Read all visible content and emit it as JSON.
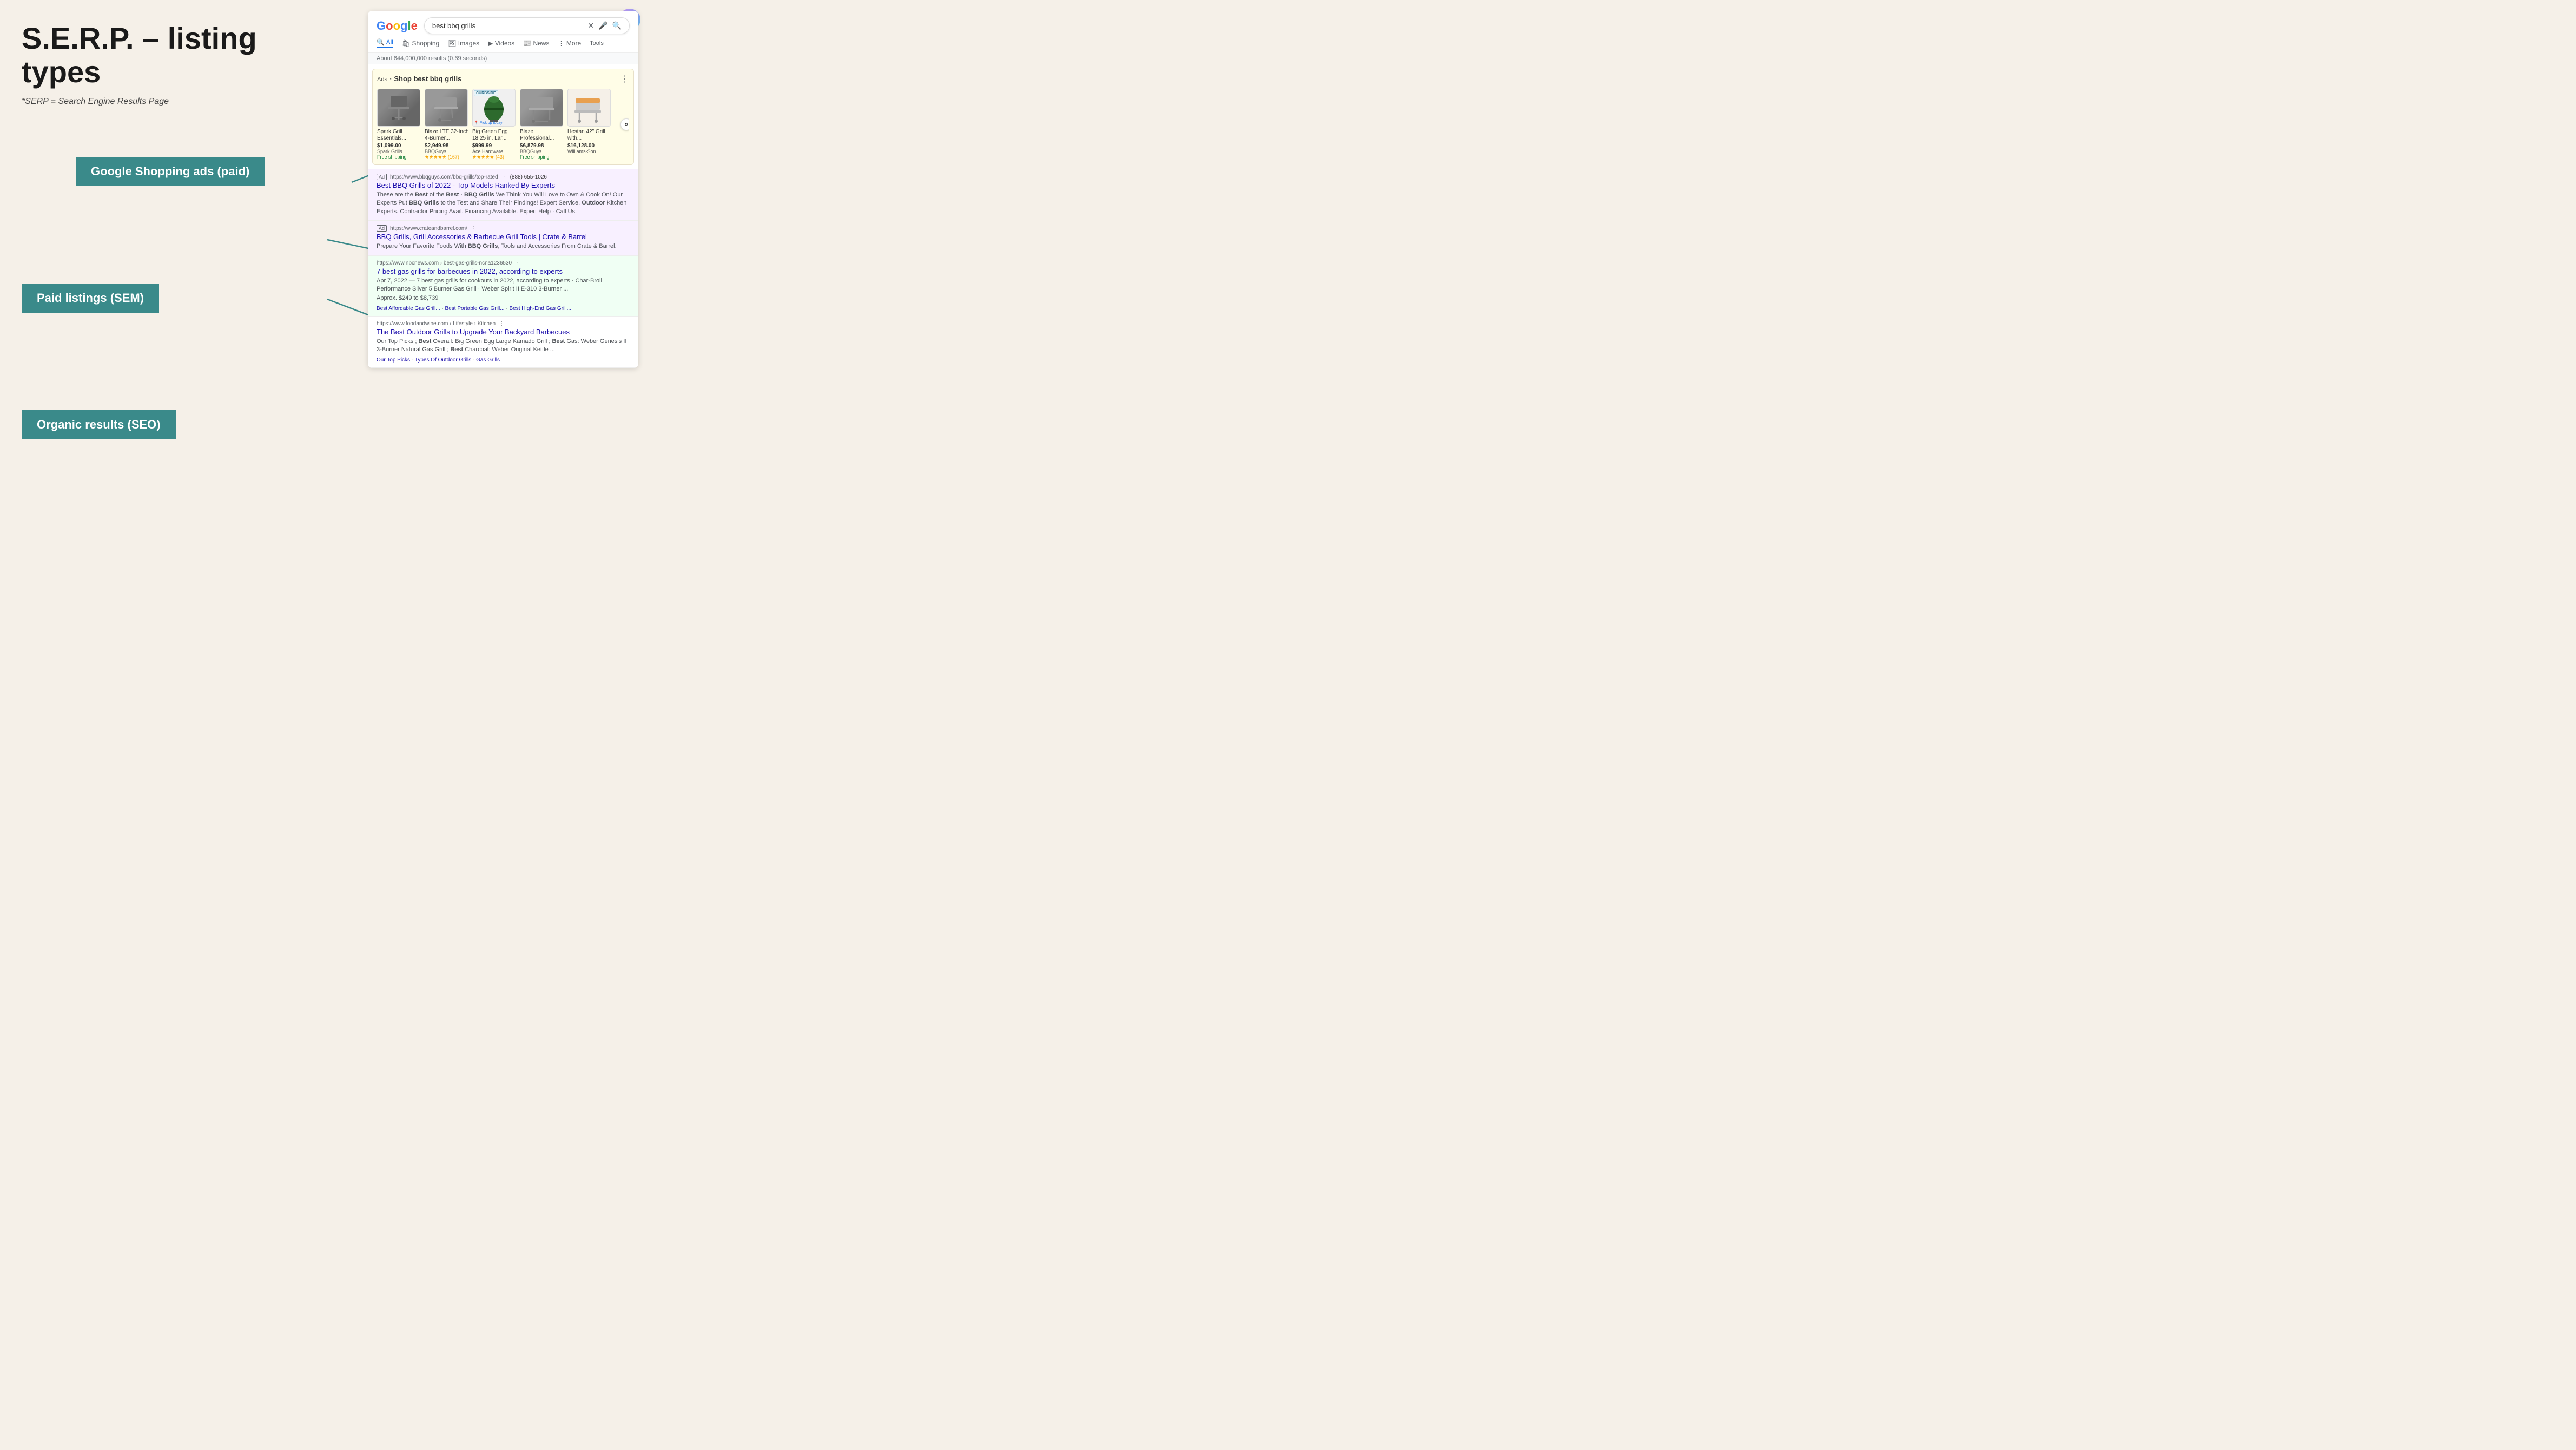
{
  "page": {
    "background_color": "#f5f0e8",
    "title": "S.E.R.P. – listing types",
    "subtitle": "*SERP = Search Engine Results Page"
  },
  "labels": {
    "shopping": "Google Shopping ads (paid)",
    "sem": "Paid listings (SEM)",
    "seo": "Organic results (SEO)"
  },
  "google": {
    "logo": "Google",
    "search_query": "best bbq grills",
    "results_count": "About 644,000,000 results (0.69 seconds)",
    "nav_items": [
      "All",
      "Shopping",
      "Images",
      "Videos",
      "News",
      "More",
      "Tools"
    ],
    "nav_active": "All"
  },
  "shopping_ads": {
    "label": "Ads",
    "title": "· Shop best bbq grills",
    "items": [
      {
        "name": "Spark Grill Essentials...",
        "price": "$1,099.00",
        "seller": "Spark Grills",
        "shipping": "Free shipping",
        "stars": "",
        "review_count": ""
      },
      {
        "name": "Blaze LTE 32-Inch 4-Burner...",
        "price": "$2,949.98",
        "seller": "BBQGuys",
        "shipping": "",
        "stars": "★★★★★",
        "review_count": "(167)"
      },
      {
        "name": "Big Green Egg 18.25 in. Lar...",
        "price": "$999.99",
        "seller": "Ace Hardware",
        "shipping": "",
        "stars": "★★★★★",
        "review_count": "(43)",
        "curbside": "CURBSIDE",
        "pickup": "Pick up today"
      },
      {
        "name": "Blaze Professional...",
        "price": "$6,879.98",
        "seller": "BBQGuys",
        "shipping": "Free shipping",
        "stars": "",
        "review_count": ""
      },
      {
        "name": "Hestan 42\" Grill with...",
        "price": "$16,128.00",
        "seller": "Williams-Son...",
        "shipping": "",
        "stars": "",
        "review_count": ""
      }
    ]
  },
  "paid_listings": [
    {
      "ad_label": "Ad",
      "url": "https://www.bbqguys.com/bbq-grills/top-rated",
      "phone": "(888) 655-1026",
      "title": "Best BBQ Grills of 2022 - Top Models Ranked By Experts",
      "description": "These are the Best of the Best - BBQ Grills We Think You Will Love to Own & Cook On! Our Experts Put BBQ Grills to the Test and Share Their Findings! Expert Service. Outdoor Kitchen Experts. Contractor Pricing Avail. Financing Available. Expert Help · Call Us."
    },
    {
      "ad_label": "Ad",
      "url": "https://www.crateandbarrel.com/",
      "phone": "",
      "title": "BBQ Grills, Grill Accessories & Barbecue Grill Tools | Crate & Barrel",
      "description": "Prepare Your Favorite Foods With BBQ Grills, Tools and Accessories From Crate & Barrel."
    }
  ],
  "organic_results": [
    {
      "url": "https://www.nbcnews.com › best-gas-grills-ncna1236530",
      "title": "7 best gas grills for barbecues in 2022, according to experts",
      "date": "Apr 7, 2022",
      "description": "7 best gas grills for cookouts in 2022, according to experts · Char-Broil Performance Silver 5 Burner Gas Grill · Weber Spirit II E-310 3-Burner ...",
      "price_range": "Approx. $249 to $8,739",
      "links": [
        "Best Affordable Gas Grill...",
        "Best Portable Gas Grill...",
        "Best High-End Gas Grill..."
      ]
    },
    {
      "url": "https://www.foodandwine.com › Lifestyle › Kitchen",
      "title": "The Best Outdoor Grills to Upgrade Your Backyard Barbecues",
      "date": "",
      "description": "Our Top Picks ; Best Overall: Big Green Egg Large Kamado Grill ; Best Gas: Weber Genesis II 3-Burner Natural Gas Grill ; Best Charcoal: Weber Original Kettle ...",
      "links": [
        "Our Top Picks",
        "Types Of Outdoor Grills",
        "Gas Grills"
      ]
    }
  ]
}
